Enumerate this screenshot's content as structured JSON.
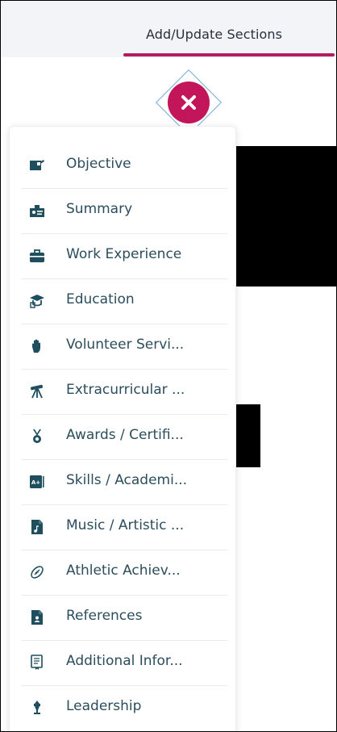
{
  "header": {
    "tab_label": "Add/Update Sections",
    "accent_color": "#b21d5f"
  },
  "close_button": {
    "icon": "close-icon",
    "color": "#c3165a"
  },
  "sections_menu": {
    "items": [
      {
        "label": "Objective",
        "icon": "objective-icon"
      },
      {
        "label": "Summary",
        "icon": "summary-icon"
      },
      {
        "label": "Work Experience",
        "icon": "briefcase-icon"
      },
      {
        "label": "Education",
        "icon": "education-icon"
      },
      {
        "label": "Volunteer Servi...",
        "icon": "hand-icon"
      },
      {
        "label": "Extracurricular ...",
        "icon": "telescope-icon"
      },
      {
        "label": "Awards / Certifi...",
        "icon": "medal-icon"
      },
      {
        "label": "Skills / Academi...",
        "icon": "skills-icon"
      },
      {
        "label": "Music / Artistic ...",
        "icon": "music-file-icon"
      },
      {
        "label": "Athletic Achiev...",
        "icon": "football-icon"
      },
      {
        "label": "References",
        "icon": "person-file-icon"
      },
      {
        "label": "Additional Infor...",
        "icon": "document-icon"
      },
      {
        "label": "Leadership",
        "icon": "trophy-icon"
      }
    ],
    "text_color": "#2b4d5c",
    "icon_color": "#1f4f5f"
  }
}
